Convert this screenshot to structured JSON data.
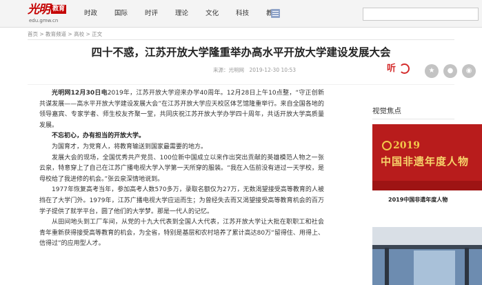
{
  "header": {
    "logo_text": "光明",
    "logo_tag": "教育",
    "logo_url_text": "edu.gmw.cn",
    "nav": [
      "时政",
      "国际",
      "时评",
      "理论",
      "文化",
      "科技",
      "教育"
    ],
    "search_placeholder": ""
  },
  "breadcrumb": "首页 > 教育频道 > 高校 > 正文",
  "article": {
    "title": "四十不惑，江苏开放大学隆重举办高水平开放大学建设发展大会",
    "meta": "来源：光明网　2019-12-30 10:53",
    "listen_label": "听",
    "lead_tag": "光明网12月30日电",
    "paragraphs": [
      {
        "text": "2019年，江苏开放大学迎来办学40周年。12月28日上午10点整，“守正创新共谋发展——高水平开放大学建设发展大会”在江苏开放大学应天校区体艺馆隆重举行。来自全国各地的领导嘉宾、专家学者、师生校友齐聚一堂，共同庆祝江苏开放大学办学四十周年，共话开放大学高质量发展。",
        "bold": false
      },
      {
        "text": "不忘初心，办有担当的开放大学。",
        "bold": true
      },
      {
        "text": "为国育才，为党育人，将教育输送到国家最需要的地方。",
        "bold": false
      },
      {
        "text": "发展大会的现场，全国优秀共产党员、100位新中国成立以来作出突出贡献的英雄模范人物之一张云泉，特意穿上了自己在江苏广播电视大学入学第一天所穿的服装。“我在入伍前没有进过一天学校，是母校给了我进修的机会。”张云泉深情地说到。",
        "bold": false
      },
      {
        "text": "1977年恢复高考当年，参加高考人数570多万，录取名额仅为27万，无数渴望接受高等教育的人被挡在了大学门外。1979年，江苏广播电视大学应运而生；为曾经失去而又渴望接受高等教育机会的百万学子提供了就学平台，圆了他们的大学梦。那是一代人的记忆。",
        "bold": false
      },
      {
        "text": "从田间地头到工厂车间，从党的十九大代表到全国人大代表，江苏开放大学让大批在职职工和社会青年重新获得接受高等教育的机会，为全省，特别是基层和农村培养了累计高达80万“留得住、用得上、信得过”的应用型人才。",
        "bold": false
      }
    ]
  },
  "sidebar": {
    "title": "视觉焦点",
    "video1": {
      "year_text": "2019",
      "banner_text": "中国非遗年度人物",
      "caption": "2019中国非遗年度人物"
    }
  },
  "colors": {
    "brand_red": "#c40000",
    "listen_red": "#d42a2a",
    "menu_icon": "#8fa3c8"
  }
}
